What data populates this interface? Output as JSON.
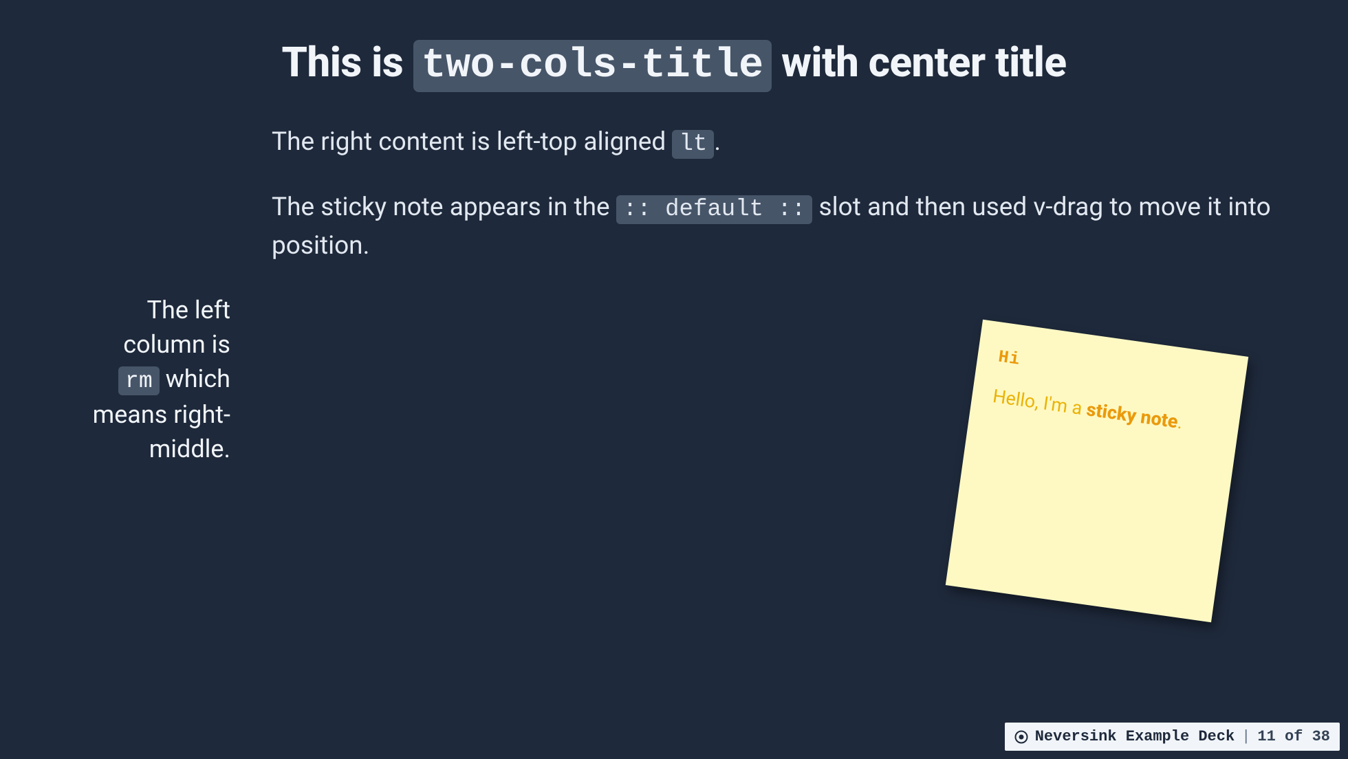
{
  "title": {
    "prefix": "This is ",
    "code": "two-cols-title",
    "suffix": " with center title"
  },
  "left": {
    "text_before": "The left column is ",
    "code": "rm",
    "text_after": " which means right-middle."
  },
  "right": {
    "p1_before": "The right content is left-top aligned ",
    "p1_code": "lt",
    "p1_after": ".",
    "p2_before": "The sticky note appears in the ",
    "p2_code": ":: default ::",
    "p2_after": " slot and then used v-drag to move it into position."
  },
  "sticky": {
    "heading": "Hi",
    "body_before": "Hello, I'm a ",
    "body_strong": "sticky note",
    "body_after": "."
  },
  "footer": {
    "deck": "Neversink Example Deck",
    "separator": "|",
    "page": "11 of 38"
  }
}
